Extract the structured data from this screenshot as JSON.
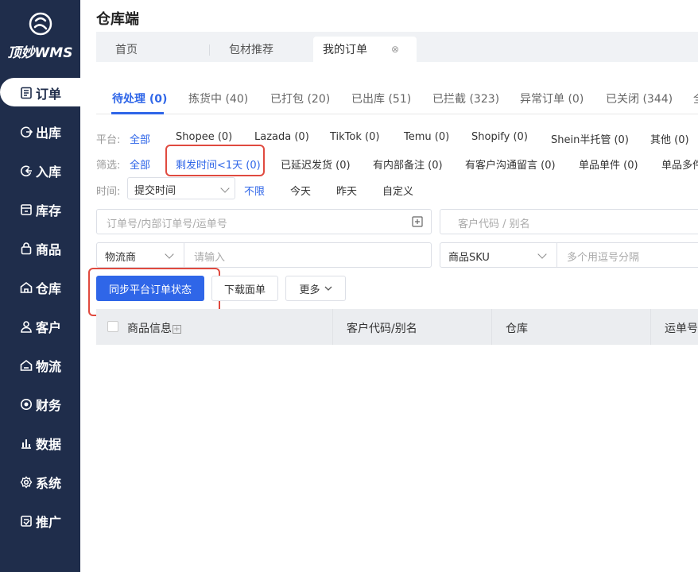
{
  "app": {
    "logo_text": "顶妙WMS",
    "page_title": "仓库端"
  },
  "sidebar": {
    "items": [
      {
        "label": "订单",
        "icon": "order-icon"
      },
      {
        "label": "出库",
        "icon": "outbound-icon"
      },
      {
        "label": "入库",
        "icon": "inbound-icon"
      },
      {
        "label": "库存",
        "icon": "inventory-icon"
      },
      {
        "label": "商品",
        "icon": "product-icon"
      },
      {
        "label": "仓库",
        "icon": "warehouse-icon"
      },
      {
        "label": "客户",
        "icon": "customer-icon"
      },
      {
        "label": "物流",
        "icon": "logistics-icon"
      },
      {
        "label": "财务",
        "icon": "finance-icon"
      },
      {
        "label": "数据",
        "icon": "data-icon"
      },
      {
        "label": "系统",
        "icon": "settings-icon"
      },
      {
        "label": "推广",
        "icon": "promotion-icon"
      }
    ]
  },
  "tabs": [
    {
      "label": "首页"
    },
    {
      "label": "包材推荐"
    },
    {
      "label": "我的订单"
    }
  ],
  "status_tabs": [
    "待处理 (0)",
    "拣货中 (40)",
    "已打包 (20)",
    "已出库 (51)",
    "已拦截 (323)",
    "异常订单 (0)",
    "已关闭 (344)",
    "全"
  ],
  "platform": {
    "label": "平台:",
    "options": [
      "全部",
      "Shopee (0)",
      "Lazada (0)",
      "TikTok (0)",
      "Temu (0)",
      "Shopify (0)",
      "Shein半托管 (0)",
      "其他 (0)"
    ]
  },
  "filter": {
    "label": "筛选:",
    "options": [
      "全部",
      "剩发时间<1天 (0)",
      "已延迟发货 (0)",
      "有内部备注 (0)",
      "有客户沟通留言 (0)",
      "单品单件 (0)",
      "单品多件"
    ]
  },
  "time": {
    "label": "时间:",
    "select_value": "提交时间",
    "options": [
      "不限",
      "今天",
      "昨天",
      "自定义"
    ]
  },
  "search": {
    "order_placeholder": "订单号/内部订单号/运单号",
    "customer_placeholder": "客户代码 / 别名",
    "carrier_select": "物流商",
    "carrier_placeholder": "请输入",
    "sku_select": "商品SKU",
    "sku_placeholder": "多个用逗号分隔"
  },
  "actions": {
    "sync_label": "同步平台订单状态",
    "download_label": "下载面单",
    "more_label": "更多"
  },
  "table": {
    "columns": [
      "商品信息",
      "客户代码/别名",
      "仓库",
      "运单号"
    ]
  },
  "colors": {
    "primary": "#2f66e8",
    "sidebar": "#1f2d4b",
    "highlight": "#e04a3f"
  }
}
